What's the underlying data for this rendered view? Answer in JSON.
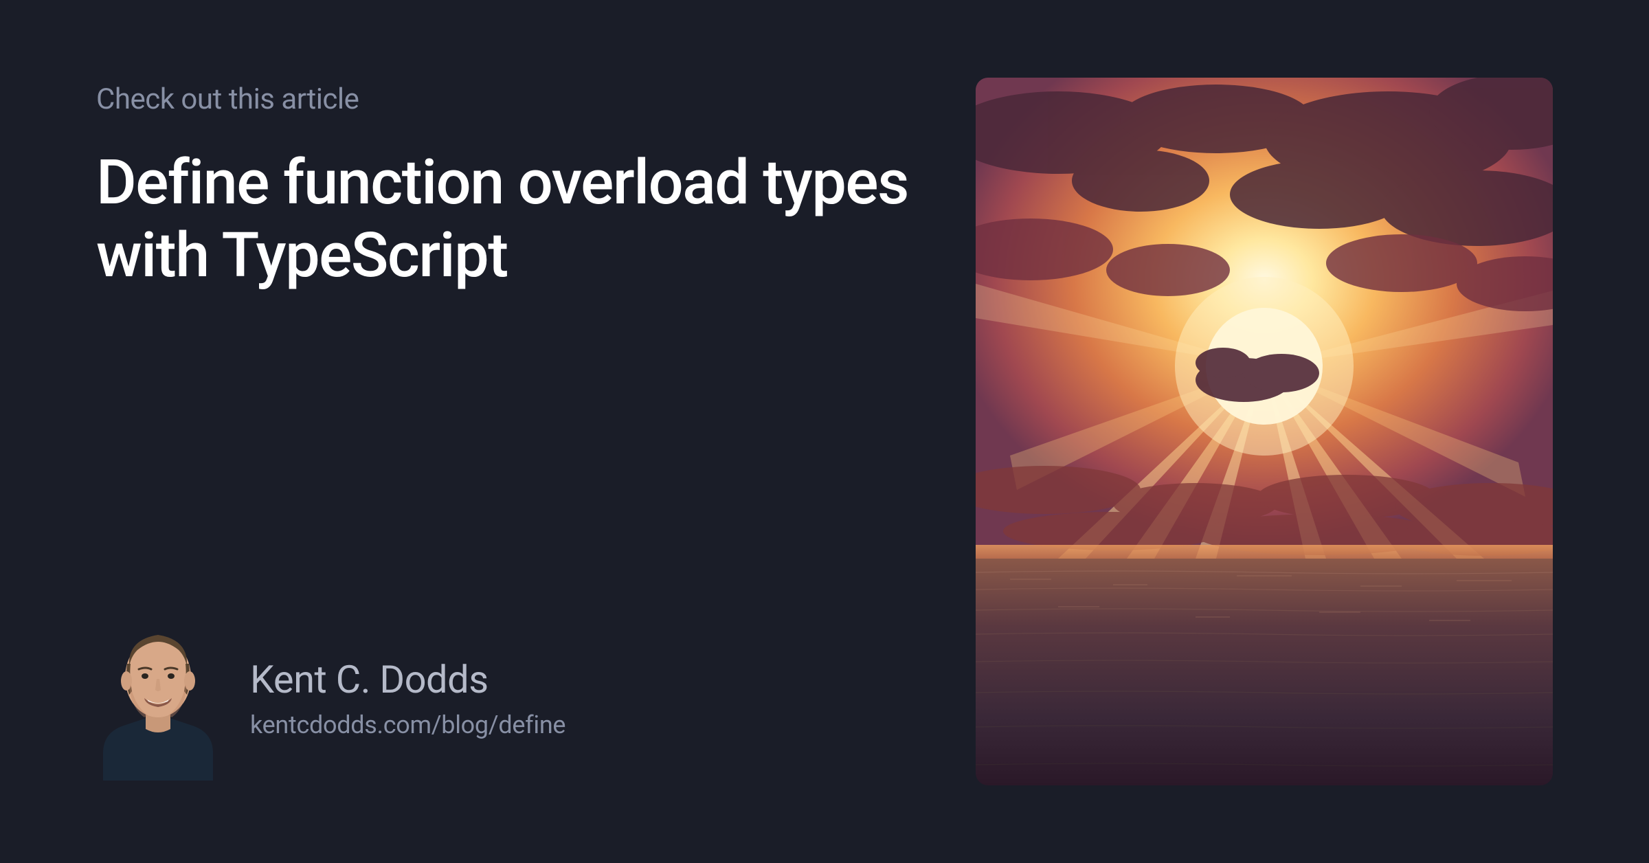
{
  "eyebrow": "Check out this article",
  "title": "Define function overload types with TypeScript",
  "author": {
    "name": "Kent C. Dodds",
    "url": "kentcdodds.com/blog/define"
  }
}
